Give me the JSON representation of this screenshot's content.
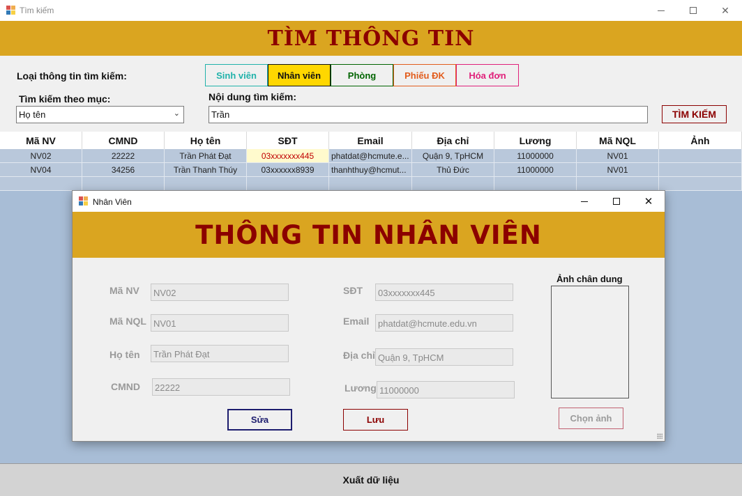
{
  "window": {
    "title": "Tìm kiếm"
  },
  "banner": {
    "title": "TÌM THÔNG TIN"
  },
  "search": {
    "type_label": "Loại thông tin tìm kiếm:",
    "types": [
      {
        "label": "Sinh viên",
        "color": "#20b2aa",
        "selected": false
      },
      {
        "label": "Nhân viên",
        "color": "#111111",
        "selected": true
      },
      {
        "label": "Phòng",
        "color": "#006400",
        "selected": false
      },
      {
        "label": "Phiếu ĐK",
        "color": "#e25c1c",
        "selected": false
      },
      {
        "label": "Hóa đơn",
        "color": "#e0207a",
        "selected": false
      }
    ],
    "by_label": "Tìm kiếm theo mục:",
    "by_value": "Họ tên",
    "content_label": "Nội dung tìm kiếm:",
    "content_value": "Trần",
    "button": "TÌM KIẾM"
  },
  "table": {
    "columns": [
      "Mã NV",
      "CMND",
      "Họ tên",
      "SĐT",
      "Email",
      "Địa chỉ",
      "Lương",
      "Mã NQL",
      "Ảnh"
    ],
    "rows": [
      [
        "NV02",
        "22222",
        "Trần Phát Đạt",
        "03xxxxxxx445",
        "phatdat@hcmute.e...",
        "Quận 9, TpHCM",
        "11000000",
        "NV01",
        ""
      ],
      [
        "NV04",
        "34256",
        "Trần Thanh Thúy",
        "03xxxxxx8939",
        "thanhthuy@hcmut...",
        "Thủ Đức",
        "11000000",
        "NV01",
        ""
      ]
    ]
  },
  "export_label": "Xuất dữ liệu",
  "dialog": {
    "title": "Nhân Viên",
    "banner": "THÔNG TIN NHÂN VIÊN",
    "fields": {
      "ma_nv": {
        "label": "Mã NV",
        "value": "NV02"
      },
      "ma_nql": {
        "label": "Mã NQL",
        "value": "NV01"
      },
      "ho_ten": {
        "label": "Họ tên",
        "value": "Trần Phát Đạt"
      },
      "cmnd": {
        "label": "CMND",
        "value": "22222"
      },
      "sdt": {
        "label": "SĐT",
        "value": "03xxxxxxx445"
      },
      "email": {
        "label": "Email",
        "value": "phatdat@hcmute.edu.vn"
      },
      "dia_chi": {
        "label": "Địa chỉ",
        "value": "Quận 9, TpHCM"
      },
      "luong": {
        "label": "Lương",
        "value": "11000000"
      }
    },
    "photo_label": "Ảnh chân dung",
    "edit_button": "Sửa",
    "save_button": "Lưu",
    "choose_photo_button": "Chọn ảnh"
  },
  "colors": {
    "banner": "#daa520",
    "banner_text": "#8b0000",
    "grid_background": "#a8bdd6"
  }
}
